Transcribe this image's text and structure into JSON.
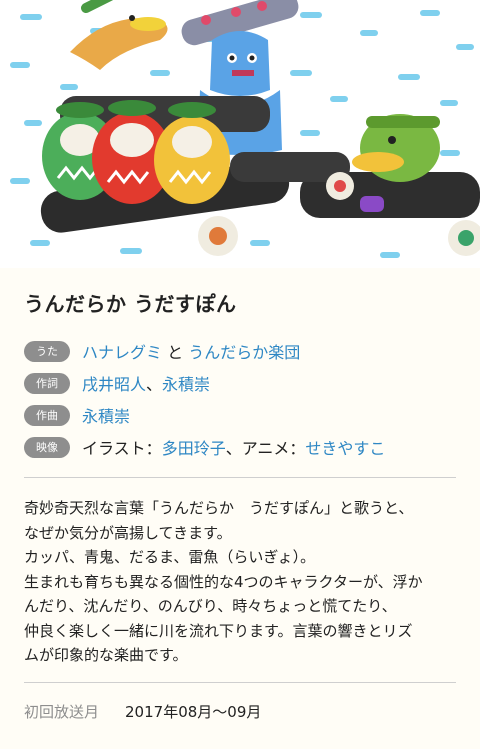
{
  "title": "うんだらか うだすぽん",
  "credits": {
    "uta": {
      "badge": "うた",
      "link1": "ハナレグミ",
      "joiner": " と ",
      "link2": "うんだらか楽団"
    },
    "lyrics": {
      "badge": "作詞",
      "link1": "戌井昭人",
      "sep": "、",
      "link2": "永積崇"
    },
    "composition": {
      "badge": "作曲",
      "link1": "永積崇"
    },
    "visuals": {
      "badge": "映像",
      "label1": "イラスト：",
      "link1": "多田玲子",
      "sep": "、",
      "label2": "アニメ：",
      "link2": "せきやすこ"
    }
  },
  "description": [
    "奇妙奇天烈な言葉「うんだらか　うだすぽん」と歌うと、",
    "なぜか気分が高揚してきます。",
    "カッパ、青鬼、だるま、雷魚（らいぎょ）。",
    "生まれも育ちも異なる個性的な4つのキャラクターが、浮か",
    "んだり、沈んだり、のんびり、時々ちょっと慌てたり、",
    "仲良く楽しく一緒に川を流れ下ります。言葉の響きとリズ",
    "ムが印象的な楽曲です。"
  ],
  "broadcast": {
    "label": "初回放送月",
    "value": "2017年08月〜09月"
  },
  "colors": {
    "link": "#2e87c4",
    "badge": "#8e8e8e",
    "background": "#fffdf6"
  }
}
